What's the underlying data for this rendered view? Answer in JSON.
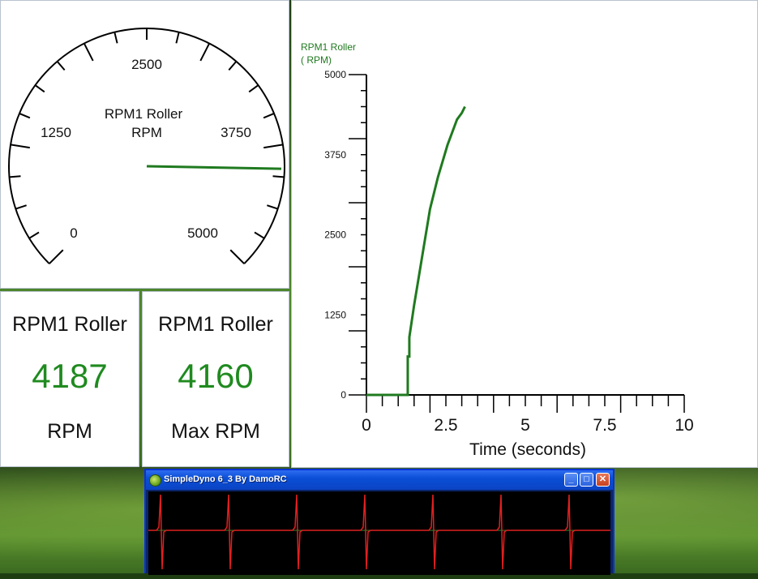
{
  "gauge": {
    "title": "RPM1 Roller",
    "unit": "RPM",
    "labels": [
      "0",
      "1250",
      "2500",
      "3750",
      "5000"
    ],
    "value": 4187,
    "max": 5000,
    "needle_color": "#1f7a1f"
  },
  "readouts": [
    {
      "title": "RPM1 Roller",
      "value": "4187",
      "unit": "RPM"
    },
    {
      "title": "RPM1 Roller",
      "value": "4160",
      "unit": "Max RPM"
    }
  ],
  "chart_data": {
    "type": "line",
    "ylabel_line1": "RPM1 Roller",
    "ylabel_line2": "( RPM)",
    "xlabel": "Time (seconds)",
    "xlim": [
      0,
      10
    ],
    "ylim": [
      0,
      5000
    ],
    "x_ticks": [
      "0",
      "2.5",
      "5",
      "7.5",
      "10"
    ],
    "y_ticks": [
      "0",
      "1250",
      "2500",
      "3750",
      "5000"
    ],
    "series": [
      {
        "color": "#1f7a1f",
        "x": [
          0,
          1.3,
          1.3,
          1.35,
          1.35,
          1.5,
          1.6,
          1.7,
          1.8,
          1.9,
          2.0,
          2.1,
          2.25,
          2.4,
          2.55,
          2.7,
          2.85,
          3.0,
          3.1
        ],
        "y": [
          0,
          0,
          600,
          600,
          900,
          1400,
          1700,
          2000,
          2300,
          2600,
          2900,
          3100,
          3400,
          3650,
          3900,
          4100,
          4300,
          4400,
          4500
        ]
      }
    ]
  },
  "window": {
    "title": "SimpleDyno 6_3 By DamoRC",
    "min_label": "_",
    "max_label": "□",
    "close_label": "✕",
    "trace_color": "#e02020",
    "baseline_color": "#2e8a2e"
  }
}
